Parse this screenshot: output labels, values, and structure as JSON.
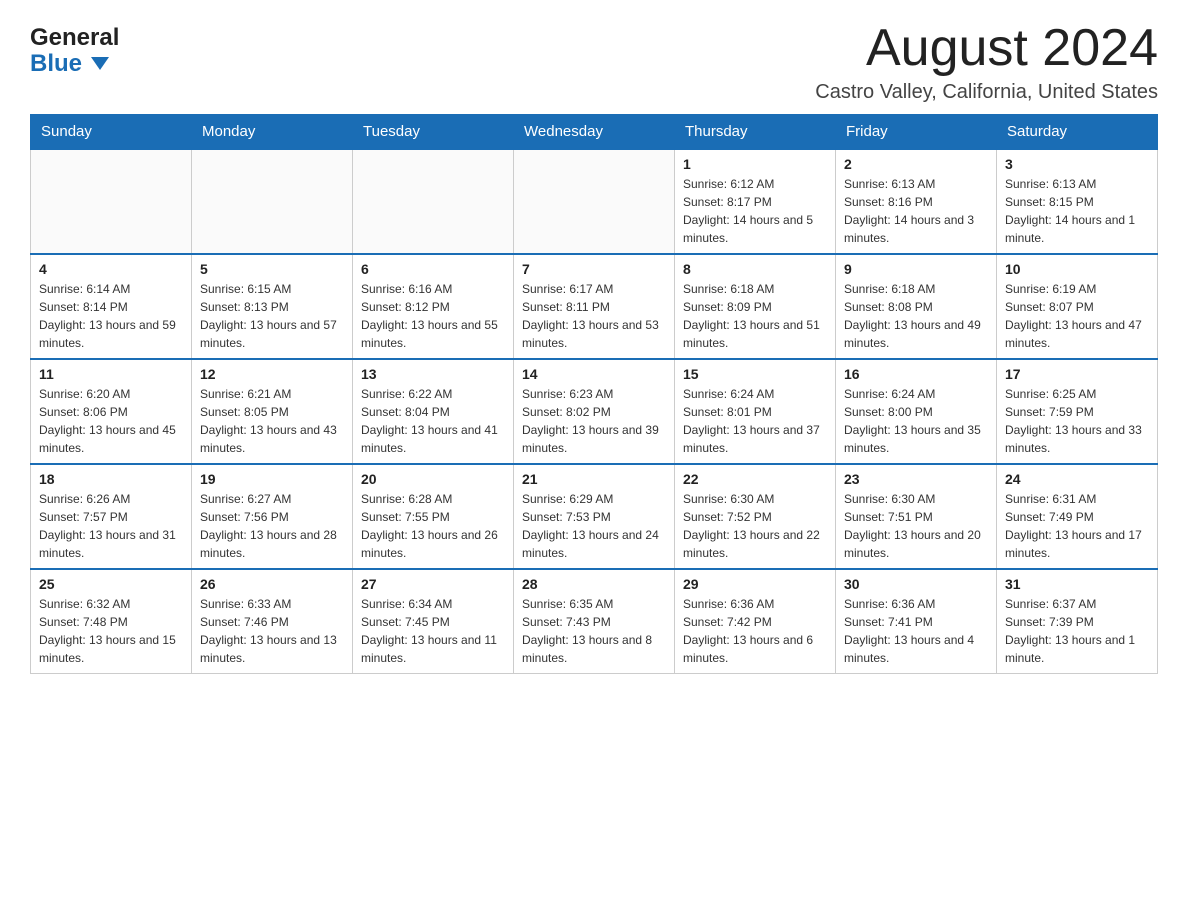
{
  "header": {
    "logo_general": "General",
    "logo_blue": "Blue",
    "month_title": "August 2024",
    "location": "Castro Valley, California, United States"
  },
  "days_of_week": [
    "Sunday",
    "Monday",
    "Tuesday",
    "Wednesday",
    "Thursday",
    "Friday",
    "Saturday"
  ],
  "weeks": [
    [
      {
        "day": "",
        "info": ""
      },
      {
        "day": "",
        "info": ""
      },
      {
        "day": "",
        "info": ""
      },
      {
        "day": "",
        "info": ""
      },
      {
        "day": "1",
        "info": "Sunrise: 6:12 AM\nSunset: 8:17 PM\nDaylight: 14 hours and 5 minutes."
      },
      {
        "day": "2",
        "info": "Sunrise: 6:13 AM\nSunset: 8:16 PM\nDaylight: 14 hours and 3 minutes."
      },
      {
        "day": "3",
        "info": "Sunrise: 6:13 AM\nSunset: 8:15 PM\nDaylight: 14 hours and 1 minute."
      }
    ],
    [
      {
        "day": "4",
        "info": "Sunrise: 6:14 AM\nSunset: 8:14 PM\nDaylight: 13 hours and 59 minutes."
      },
      {
        "day": "5",
        "info": "Sunrise: 6:15 AM\nSunset: 8:13 PM\nDaylight: 13 hours and 57 minutes."
      },
      {
        "day": "6",
        "info": "Sunrise: 6:16 AM\nSunset: 8:12 PM\nDaylight: 13 hours and 55 minutes."
      },
      {
        "day": "7",
        "info": "Sunrise: 6:17 AM\nSunset: 8:11 PM\nDaylight: 13 hours and 53 minutes."
      },
      {
        "day": "8",
        "info": "Sunrise: 6:18 AM\nSunset: 8:09 PM\nDaylight: 13 hours and 51 minutes."
      },
      {
        "day": "9",
        "info": "Sunrise: 6:18 AM\nSunset: 8:08 PM\nDaylight: 13 hours and 49 minutes."
      },
      {
        "day": "10",
        "info": "Sunrise: 6:19 AM\nSunset: 8:07 PM\nDaylight: 13 hours and 47 minutes."
      }
    ],
    [
      {
        "day": "11",
        "info": "Sunrise: 6:20 AM\nSunset: 8:06 PM\nDaylight: 13 hours and 45 minutes."
      },
      {
        "day": "12",
        "info": "Sunrise: 6:21 AM\nSunset: 8:05 PM\nDaylight: 13 hours and 43 minutes."
      },
      {
        "day": "13",
        "info": "Sunrise: 6:22 AM\nSunset: 8:04 PM\nDaylight: 13 hours and 41 minutes."
      },
      {
        "day": "14",
        "info": "Sunrise: 6:23 AM\nSunset: 8:02 PM\nDaylight: 13 hours and 39 minutes."
      },
      {
        "day": "15",
        "info": "Sunrise: 6:24 AM\nSunset: 8:01 PM\nDaylight: 13 hours and 37 minutes."
      },
      {
        "day": "16",
        "info": "Sunrise: 6:24 AM\nSunset: 8:00 PM\nDaylight: 13 hours and 35 minutes."
      },
      {
        "day": "17",
        "info": "Sunrise: 6:25 AM\nSunset: 7:59 PM\nDaylight: 13 hours and 33 minutes."
      }
    ],
    [
      {
        "day": "18",
        "info": "Sunrise: 6:26 AM\nSunset: 7:57 PM\nDaylight: 13 hours and 31 minutes."
      },
      {
        "day": "19",
        "info": "Sunrise: 6:27 AM\nSunset: 7:56 PM\nDaylight: 13 hours and 28 minutes."
      },
      {
        "day": "20",
        "info": "Sunrise: 6:28 AM\nSunset: 7:55 PM\nDaylight: 13 hours and 26 minutes."
      },
      {
        "day": "21",
        "info": "Sunrise: 6:29 AM\nSunset: 7:53 PM\nDaylight: 13 hours and 24 minutes."
      },
      {
        "day": "22",
        "info": "Sunrise: 6:30 AM\nSunset: 7:52 PM\nDaylight: 13 hours and 22 minutes."
      },
      {
        "day": "23",
        "info": "Sunrise: 6:30 AM\nSunset: 7:51 PM\nDaylight: 13 hours and 20 minutes."
      },
      {
        "day": "24",
        "info": "Sunrise: 6:31 AM\nSunset: 7:49 PM\nDaylight: 13 hours and 17 minutes."
      }
    ],
    [
      {
        "day": "25",
        "info": "Sunrise: 6:32 AM\nSunset: 7:48 PM\nDaylight: 13 hours and 15 minutes."
      },
      {
        "day": "26",
        "info": "Sunrise: 6:33 AM\nSunset: 7:46 PM\nDaylight: 13 hours and 13 minutes."
      },
      {
        "day": "27",
        "info": "Sunrise: 6:34 AM\nSunset: 7:45 PM\nDaylight: 13 hours and 11 minutes."
      },
      {
        "day": "28",
        "info": "Sunrise: 6:35 AM\nSunset: 7:43 PM\nDaylight: 13 hours and 8 minutes."
      },
      {
        "day": "29",
        "info": "Sunrise: 6:36 AM\nSunset: 7:42 PM\nDaylight: 13 hours and 6 minutes."
      },
      {
        "day": "30",
        "info": "Sunrise: 6:36 AM\nSunset: 7:41 PM\nDaylight: 13 hours and 4 minutes."
      },
      {
        "day": "31",
        "info": "Sunrise: 6:37 AM\nSunset: 7:39 PM\nDaylight: 13 hours and 1 minute."
      }
    ]
  ]
}
